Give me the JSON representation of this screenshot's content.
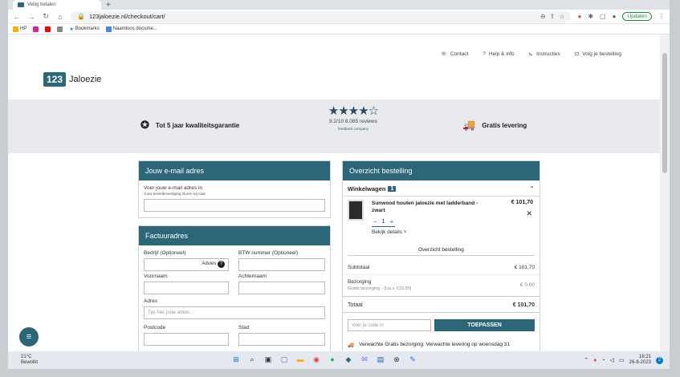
{
  "browser": {
    "tab_title": "Veilig betalen",
    "url": "123jaloezie.nl/checkout/cart/",
    "update_label": "Updaten",
    "bookmarks": [
      "HP",
      "Bookmarks",
      "Naamloos docume..."
    ]
  },
  "site": {
    "logo_number": "123",
    "logo_name": "Jaloezie",
    "nav": [
      "Contact",
      "Help & info",
      "Instructies",
      "Volg je bestelling"
    ],
    "usp_warranty": "Tot 5 jaar kwaliteitsgarantie",
    "usp_shipping": "Gratis levering",
    "rating_stars": "★★★★☆",
    "rating_text": "9.2/10 8.085 reviews",
    "feedback_label": "feedback company"
  },
  "email_panel": {
    "title": "Jouw e-mail adres",
    "label": "Voer jouw e-mail adres in",
    "hint": "Jouw bestelbevestiging sturen wij naar",
    "value": ""
  },
  "address_panel": {
    "title": "Factuuradres",
    "company_label": "Bedrijf (Optioneel)",
    "advice_label": "Advies",
    "vat_label": "BTW nummer (Optioneel)",
    "firstname_label": "Voornaam",
    "lastname_label": "Achternaam",
    "address_label": "Adres",
    "address_placeholder": "Typ hier jouw adres...",
    "postcode_label": "Postcode",
    "city_label": "Stad"
  },
  "order_panel": {
    "title": "Overzicht bestelling",
    "cart_label": "Winkelwagen",
    "cart_count": "1",
    "product_name": "Sunwood houten jaloezie met ladderband - zwart",
    "product_price": "€ 101,70",
    "quantity": "1",
    "details_label": "Bekijk details",
    "summary_header": "Overzicht bestelling",
    "subtotal_label": "Subtotaal",
    "subtotal_value": "€ 101,70",
    "shipping_label": "Bezorging",
    "shipping_sub": "Gratis bezorging - (t.w.v. €15,95)",
    "shipping_value": "€ 0,00",
    "total_label": "Totaal",
    "total_value": "€ 101,70",
    "code_placeholder": "Voer je code in",
    "apply_label": "TOEPASSEN",
    "delivery_text": "Verwachte Gratis bezorging: Verwachte levering op woensdag 31"
  },
  "taskbar": {
    "temperature": "21°C",
    "weather": "Bewolkt",
    "time": "16:21",
    "date": "26-8-2023",
    "notifications": "2"
  },
  "colors": {
    "brand": "#2c6779",
    "arrow": "#c8102e"
  }
}
